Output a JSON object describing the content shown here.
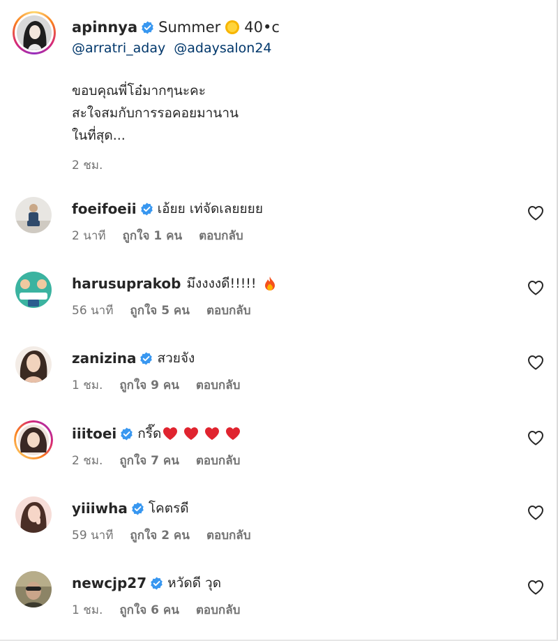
{
  "caption": {
    "username": "apinnya",
    "status_text": "Summer",
    "status_temp": "40•c",
    "mentions": [
      "@arratri_aday",
      "@adaysalon24"
    ],
    "lines": [
      "ขอบคุณพี่โอ๋มากๆนะคะ",
      "สะใจสมกับการรอคอยมานาน",
      "ในที่สุด..."
    ],
    "time": "2 ชม."
  },
  "comments": [
    {
      "username": "foeifoeii",
      "verified": true,
      "text": "เอ้ยย เท่จัดเลยยยย",
      "time": "2 นาที",
      "likes": "ถูกใจ 1 คน",
      "reply": "ตอบกลับ"
    },
    {
      "username": "harusuprakob",
      "verified": false,
      "text": "มึงงงงดี!!!!!",
      "time": "56 นาที",
      "likes": "ถูกใจ 5 คน",
      "reply": "ตอบกลับ"
    },
    {
      "username": "zanizina",
      "verified": true,
      "text": "สวยจัง",
      "time": "1 ชม.",
      "likes": "ถูกใจ 9 คน",
      "reply": "ตอบกลับ"
    },
    {
      "username": "iiitoei",
      "verified": true,
      "text": "กรี๊ด",
      "time": "2 ชม.",
      "likes": "ถูกใจ 7 คน",
      "reply": "ตอบกลับ"
    },
    {
      "username": "yiiiwha",
      "verified": true,
      "text": "โคตรดี",
      "time": "59 นาที",
      "likes": "ถูกใจ 2 คน",
      "reply": "ตอบกลับ"
    },
    {
      "username": "newcjp27",
      "verified": true,
      "text": "หวัดดี วุด",
      "time": "1 ชม.",
      "likes": "ถูกใจ 6 คน",
      "reply": "ตอบกลับ"
    }
  ],
  "icons": {
    "verified": "verified-badge-icon",
    "like": "heart-outline-icon",
    "sun": "sun-emoji-icon",
    "fire": "fire-emoji-icon",
    "red_heart": "red-heart-emoji-icon"
  },
  "colors": {
    "verified_blue": "#3897f0",
    "mention_blue": "#00376b",
    "meta_gray": "#737373",
    "text": "#262626"
  }
}
